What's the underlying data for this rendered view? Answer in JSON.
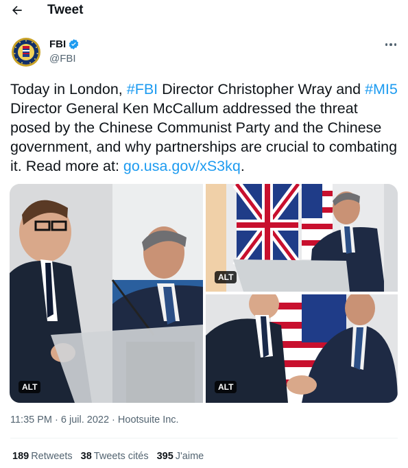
{
  "header": {
    "title": "Tweet",
    "back_icon": "arrow-left-icon"
  },
  "author": {
    "name": "FBI",
    "handle": "@FBI",
    "verified": true,
    "verified_color": "#1d9bf0",
    "avatar_icon": "fbi-seal-icon"
  },
  "tweet": {
    "text_1": "Today in London, ",
    "hashtag_fbi": "#FBI",
    "text_2": " Director Christopher Wray and ",
    "hashtag_mi5": "#MI5",
    "text_3": " Director General Ken McCallum addressed the threat posed by the Chinese Communist Party and the Chinese government, and why partnerships are crucial to combating it. Read more at: ",
    "link": "go.usa.gov/xS3kq",
    "text_4": ".",
    "link_color": "#1d9bf0"
  },
  "media": {
    "alt_label": "ALT"
  },
  "meta": {
    "time": "11:35 PM",
    "sep": " · ",
    "date": "6 juil. 2022",
    "source": "Hootsuite Inc."
  },
  "stats": {
    "retweets_count": "189",
    "retweets_label": "Retweets",
    "quotes_count": "38",
    "quotes_label": "Tweets cités",
    "likes_count": "395",
    "likes_label": "J'aime"
  }
}
